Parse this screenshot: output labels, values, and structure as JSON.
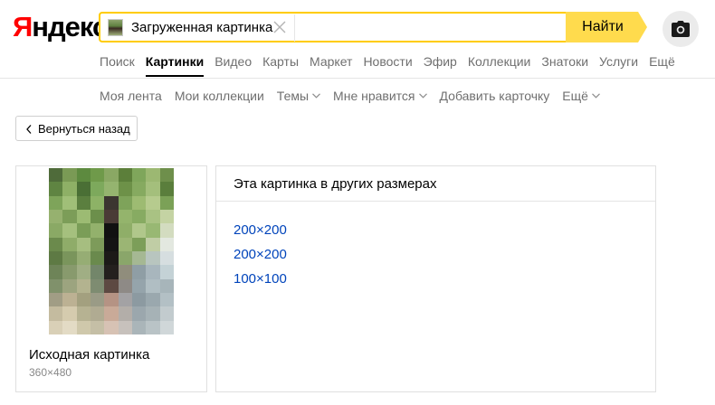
{
  "logo": {
    "first": "Я",
    "rest": "ндекс"
  },
  "search": {
    "value": "Загруженная картинка",
    "button_label": "Найти"
  },
  "colors": {
    "brand_red": "#ff0000",
    "accent_yellow": "#ffcc00",
    "link_blue": "#0044bb"
  },
  "icons": {
    "clear": "close-icon",
    "camera": "camera-icon",
    "back": "chevron-left-icon",
    "dropdown": "chevron-down-icon"
  },
  "services": [
    {
      "label": "Поиск",
      "active": false
    },
    {
      "label": "Картинки",
      "active": true
    },
    {
      "label": "Видео",
      "active": false
    },
    {
      "label": "Карты",
      "active": false
    },
    {
      "label": "Маркет",
      "active": false
    },
    {
      "label": "Новости",
      "active": false
    },
    {
      "label": "Эфир",
      "active": false
    },
    {
      "label": "Коллекции",
      "active": false
    },
    {
      "label": "Знатоки",
      "active": false
    },
    {
      "label": "Услуги",
      "active": false
    },
    {
      "label": "Ещё",
      "active": false
    }
  ],
  "subnav": [
    {
      "label": "Моя лента",
      "dropdown": false
    },
    {
      "label": "Мои коллекции",
      "dropdown": false
    },
    {
      "label": "Темы",
      "dropdown": true
    },
    {
      "label": "Мне нравится",
      "dropdown": true
    },
    {
      "label": "Добавить карточку",
      "dropdown": false
    },
    {
      "label": "Ещё",
      "dropdown": true
    }
  ],
  "back_button": {
    "label": "Вернуться назад"
  },
  "original": {
    "title": "Исходная картинка",
    "size": "360×480"
  },
  "other_sizes": {
    "title": "Эта картинка в других размерах",
    "links": [
      "200×200",
      "200×200",
      "100×100"
    ]
  }
}
